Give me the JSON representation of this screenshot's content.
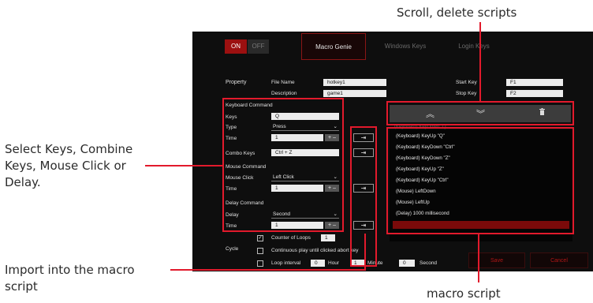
{
  "annotations": {
    "scroll_delete": "Scroll, delete scripts",
    "select_keys": [
      "Select Keys, Combine",
      "Keys, Mouse Click or",
      "Delay."
    ],
    "import_macro": [
      "Import into the macro",
      "script"
    ],
    "macro_script": "macro script"
  },
  "toggle": {
    "on": "ON",
    "off": "OFF"
  },
  "tabs": [
    "Macro Genie",
    "Windows Keys",
    "Login Keys"
  ],
  "property": {
    "title": "Property",
    "file_name_label": "File Name",
    "file_name_value": "hotkey1",
    "description_label": "Description",
    "description_value": "game1",
    "start_key_label": "Start Key",
    "start_key_value": "F1",
    "stop_key_label": "Stop Key",
    "stop_key_value": "F2"
  },
  "keyboard_command": {
    "title": "Keyboard Command",
    "keys_label": "Keys",
    "keys_value": "Q",
    "type_label": "Type",
    "type_value": "Press",
    "time_label": "Time",
    "time_value": "1",
    "combo_label": "Combo Keys",
    "combo_value": "Ctrl + Z"
  },
  "mouse_command": {
    "title": "Mouse Command",
    "click_label": "Mouse Click",
    "click_value": "Left Click",
    "time_label": "Time",
    "time_value": "1"
  },
  "delay_command": {
    "title": "Delay Command",
    "delay_label": "Delay",
    "delay_value": "Second",
    "time_label": "Time",
    "time_value": "1"
  },
  "icons": {
    "scroll_up": "chevron-up-icon",
    "scroll_down": "chevron-down-icon",
    "delete": "trash-icon",
    "import": "import-arrow-icon"
  },
  "script": {
    "partial_first": "(Keyboard) KeyDown \"Q\"",
    "items": [
      "(Keyboard) KeyUp \"Q\"",
      "(Keyboard) KeyDown \"Ctrl\"",
      "(Keyboard) KeyDown \"Z\"",
      "(Keyboard) KeyUp \"Z\"",
      "(Keyboard) KeyUp \"Ctrl\"",
      "(Mouse) LeftDown",
      "(Mouse) LeftUp",
      "(Delay) 1000 millisecond"
    ]
  },
  "cycle": {
    "title": "Cycle",
    "counter_label": "Counter of Loops",
    "counter_value": "1",
    "continuous_label": "Continuous play until clicked abort key",
    "loop_label": "Loop interval",
    "hour_value": "0",
    "hour_label": "Hour",
    "minute_value": "1",
    "minute_label": "Minute",
    "second_value": "0",
    "second_label": "Second"
  },
  "buttons": {
    "save": "Save",
    "cancel": "Cancel"
  },
  "colors": {
    "accent": "#e21a2c",
    "background": "#0e0e0e",
    "highlight_row": "#7a0a0a"
  }
}
